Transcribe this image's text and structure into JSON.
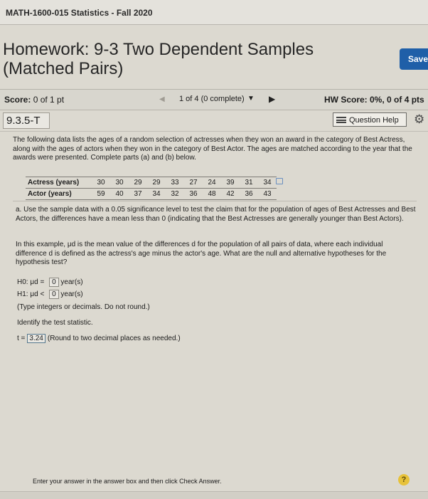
{
  "header": {
    "course": "MATH-1600-015 Statistics - Fall 2020"
  },
  "homework": {
    "title_line1": "Homework: 9-3 Two Dependent Samples",
    "title_line2": "(Matched Pairs)",
    "save_label": "Save"
  },
  "scorebar": {
    "score_label": "Score:",
    "score_value": "0 of 1 pt",
    "prev_icon": "triangle-left-icon",
    "nav_text": "1 of 4 (0 complete)",
    "dropdown_icon": "triangle-down-icon",
    "next_icon": "triangle-right-icon",
    "hw_score": "HW Score: 0%, 0 of 4 pts"
  },
  "question": {
    "number": "9.3.5-T",
    "help_label": "Question Help",
    "gear_icon": "gear-icon",
    "intro": "The following data lists the ages of a random selection of actresses when they won an award in the category of Best Actress, along with the ages of actors when they won in the category of Best Actor. The ages are matched according to the year that the awards were presented. Complete parts (a) and (b) below.",
    "table": {
      "rows": [
        {
          "label": "Actress (years)",
          "values": [
            "30",
            "30",
            "29",
            "29",
            "33",
            "27",
            "24",
            "39",
            "31",
            "34"
          ]
        },
        {
          "label": "Actor (years)",
          "values": [
            "59",
            "40",
            "37",
            "34",
            "32",
            "36",
            "48",
            "42",
            "36",
            "43"
          ]
        }
      ]
    },
    "part_a": "a. Use the sample data with a 0.05 significance level to test the claim that for the population of ages of Best Actresses and Best Actors, the differences have a mean less than 0 (indicating that the Best Actresses are generally younger than Best Actors).",
    "example": "In this example, μd is the mean value of the differences d for the population of all pairs of data, where each individual difference d is defined as the actress's age minus the actor's age. What are the null and alternative hypotheses for the hypothesis test?",
    "h0": {
      "label": "H0: μd",
      "op": "=",
      "value": "0",
      "unit": "year(s)"
    },
    "h1": {
      "label": "H1: μd",
      "op": "<",
      "value": "0",
      "unit": "year(s)"
    },
    "type_note": "(Type integers or decimals. Do not round.)",
    "identify": "Identify the test statistic.",
    "t_label": "t =",
    "t_value": "3.24",
    "t_note": "(Round to two decimal places as needed.)"
  },
  "footer": {
    "note": "Enter your answer in the answer box and then click Check Answer.",
    "help_icon": "question-mark-icon"
  }
}
